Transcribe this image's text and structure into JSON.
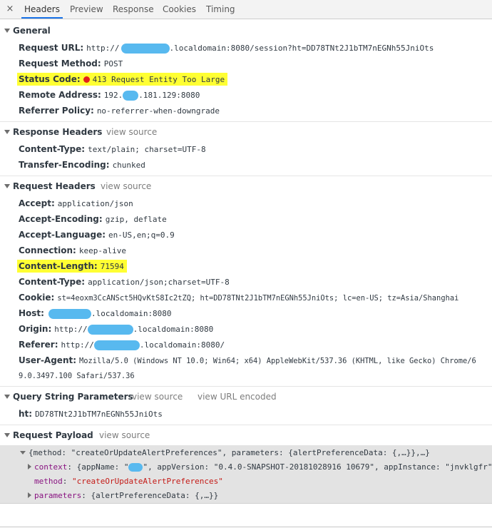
{
  "tabs": [
    {
      "label": "Headers"
    },
    {
      "label": "Preview"
    },
    {
      "label": "Response"
    },
    {
      "label": "Cookies"
    },
    {
      "label": "Timing"
    }
  ],
  "close_glyph": "×",
  "general": {
    "title": "General",
    "request_url_key": "Request URL:",
    "request_url_prefix": "http://",
    "request_url_rest": ".localdomain:8080/session?ht=DD78TNt2J1bTM7nEGNh55JniOts",
    "request_method_key": "Request Method:",
    "request_method": "POST",
    "status_code_key": "Status Code:",
    "status_code": "413 Request Entity Too Large",
    "remote_address_key": "Remote Address:",
    "remote_address_prefix": "192.",
    "remote_address_rest": ".181.129:8080",
    "referrer_policy_key": "Referrer Policy:",
    "referrer_policy": "no-referrer-when-downgrade"
  },
  "response_headers": {
    "title": "Response Headers",
    "view_source": "view source",
    "items": [
      {
        "key": "Content-Type:",
        "value": "text/plain; charset=UTF-8"
      },
      {
        "key": "Transfer-Encoding:",
        "value": "chunked"
      }
    ]
  },
  "request_headers": {
    "title": "Request Headers",
    "view_source": "view source",
    "accept_key": "Accept:",
    "accept": "application/json",
    "accept_encoding_key": "Accept-Encoding:",
    "accept_encoding": "gzip, deflate",
    "accept_language_key": "Accept-Language:",
    "accept_language": "en-US,en;q=0.9",
    "connection_key": "Connection:",
    "connection": "keep-alive",
    "content_length_key": "Content-Length:",
    "content_length": "71594",
    "content_type_key": "Content-Type:",
    "content_type": "application/json;charset=UTF-8",
    "cookie_key": "Cookie:",
    "cookie": "st=4eoxm3CcANSct5HQvKtS8Ic2tZQ; ht=DD78TNt2J1bTM7nEGNh55JniOts; lc=en-US; tz=Asia/Shanghai",
    "host_key": "Host:",
    "host_rest": ".localdomain:8080",
    "origin_key": "Origin:",
    "origin_prefix": "http://",
    "origin_rest": ".localdomain:8080",
    "referer_key": "Referer:",
    "referer_prefix": "http://",
    "referer_rest": ".localdomain:8080/",
    "user_agent_key": "User-Agent:",
    "user_agent_line1": "Mozilla/5.0 (Windows NT 10.0; Win64; x64) AppleWebKit/537.36 (KHTML, like Gecko) Chrome/6",
    "user_agent_line2": "9.0.3497.100 Safari/537.36"
  },
  "query_string": {
    "title": "Query String Parameters",
    "view_source": "view source",
    "view_url_encoded": "view URL encoded",
    "ht_key": "ht:",
    "ht_value": "DD78TNt2J1bTM7nEGNh55JniOts"
  },
  "payload": {
    "title": "Request Payload",
    "view_source": "view source",
    "root_line": "{method: \"createOrUpdateAlertPreferences\", parameters: {alertPreferenceData: {,…}},…}",
    "context_key": "context",
    "context_pre": ": {appName: \"",
    "context_post": "\", appVersion: \"0.4.0-SNAPSHOT-20181028916 10679\", appInstance: \"jnvklgfr\"}",
    "method_key": "method",
    "method_value": "\"createOrUpdateAlertPreferences\"",
    "parameters_key": "parameters",
    "parameters_value": ": {alertPreferenceData: {,…}}"
  },
  "colors": {
    "highlight": "#ffff33",
    "status_dot": "#e2211c",
    "redaction": "#58b9ef",
    "tab_underline": "#1a73e8"
  }
}
